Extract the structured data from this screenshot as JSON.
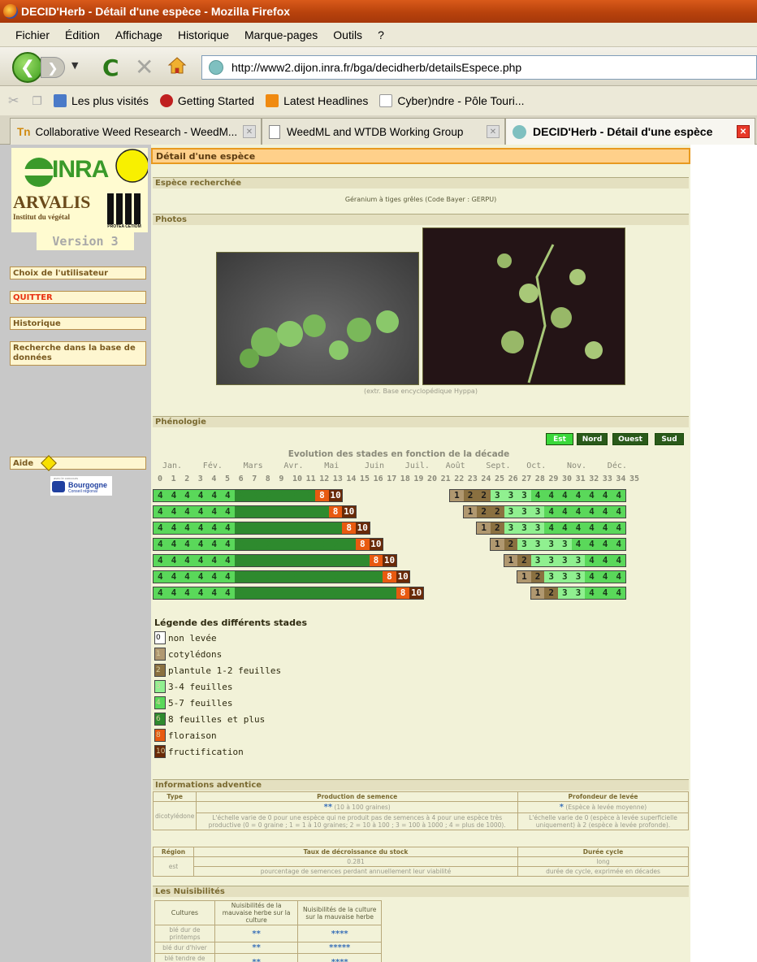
{
  "window": {
    "title": "DECID'Herb - Détail d'une espèce - Mozilla Firefox"
  },
  "menu": [
    "Fichier",
    "Édition",
    "Affichage",
    "Historique",
    "Marque-pages",
    "Outils",
    "?"
  ],
  "nav": {
    "url": "http://www2.dijon.inra.fr/bga/decidherb/detailsEspece.php"
  },
  "bookmarks": [
    "Les plus visités",
    "Getting Started",
    "Latest Headlines",
    "Cyber)ndre - Pôle Touri..."
  ],
  "tabs": [
    {
      "label": "Collaborative Weed Research - WeedM...",
      "active": false
    },
    {
      "label": "WeedML and WTDB Working Group",
      "active": false
    },
    {
      "label": "DECID'Herb - Détail d'une espèce",
      "active": true
    }
  ],
  "sidebar": {
    "logo_inra": "INRA",
    "logo_arvalis": "ARVALIS",
    "logo_arvalis_sub": "Institut du végétal",
    "logo_protea": "PROTEA CETIOM",
    "version": "Version 3",
    "items": [
      "Choix de l'utilisateur",
      "QUITTER",
      "Historique",
      "Recherche dans la base de données",
      "Aide"
    ],
    "bourgogne": "Bourgogne",
    "bourgogne_sub": "Conseil régional",
    "bourgogne_top": "avec le concours"
  },
  "page": {
    "title": "Détail d'une espèce",
    "section_search": "Espèce recherchée",
    "species": "Géranium à tiges grêles (Code Bayer : GERPU)",
    "section_photos": "Photos",
    "photo_credit": "(extr. Base encyclopédique Hyppa)",
    "section_pheno": "Phénologie",
    "region_buttons": [
      "Est",
      "Nord",
      "Ouest",
      "Sud"
    ],
    "pheno_title": "Evolution des stades en fonction de la décade",
    "months": [
      "Jan.",
      "Fév.",
      "Mars",
      "Avr.",
      "Mai",
      "Juin",
      "Juil.",
      "Août",
      "Sept.",
      "Oct.",
      "Nov.",
      "Déc."
    ],
    "decades": [
      "0",
      "1",
      "2",
      "3",
      "4",
      "5",
      "6",
      "7",
      "8",
      "9",
      "10",
      "11",
      "12",
      "13",
      "14",
      "15",
      "16",
      "17",
      "18",
      "19",
      "20",
      "21",
      "22",
      "23",
      "24",
      "25",
      "26",
      "27",
      "28",
      "29",
      "30",
      "31",
      "32",
      "33",
      "34",
      "35"
    ],
    "pheno_rows": [
      {
        "spring": "444444666666810",
        "autumn_start": 22,
        "autumn": "1223334444444"
      },
      {
        "spring": "4444446666666810",
        "autumn_start": 23,
        "autumn": "122333444444"
      },
      {
        "spring": "44444466666666810",
        "autumn_start": 24,
        "autumn": "12333444444"
      },
      {
        "spring": "444444666666666810",
        "autumn_start": 25,
        "autumn": "1233334444"
      },
      {
        "spring": "4444446666666666810",
        "autumn_start": 26,
        "autumn": "123333444"
      },
      {
        "spring": "44444466666666666810",
        "autumn_start": 27,
        "autumn": "12333444"
      },
      {
        "spring": "444444666666666666810",
        "autumn_start": 28,
        "autumn": "1233444"
      }
    ],
    "legend_title": "Légende des différents stades",
    "legend": [
      {
        "code": "0",
        "label": "non levée",
        "color": "#ffffff"
      },
      {
        "code": "1",
        "label": "cotylédons",
        "color": "#b09870"
      },
      {
        "code": "2",
        "label": "plantule 1-2 feuilles",
        "color": "#8a7040"
      },
      {
        "code": "3",
        "label": "3-4 feuilles",
        "color": "#90f090"
      },
      {
        "code": "4",
        "label": "5-7 feuilles",
        "color": "#5ad85a"
      },
      {
        "code": "6",
        "label": "8 feuilles et plus",
        "color": "#2e8a2e"
      },
      {
        "code": "8",
        "label": "floraison",
        "color": "#e85a10"
      },
      {
        "code": "10",
        "label": "fructification",
        "color": "#6a2a08"
      }
    ],
    "section_info": "Informations adventice",
    "info": {
      "h_type": "Type",
      "h_prod": "Production de semence",
      "h_prof": "Profondeur de levée",
      "type": "dicotylédone",
      "prod_stars": "**",
      "prod_val": "(10 à 100 graines)",
      "prod_desc": "L'échelle varie de 0 pour une espèce qui ne produit pas de semences à 4 pour une espèce très productive (0 = 0 graine ; 1 = 1 à 10 graines; 2 = 10 à 100 ; 3 = 100 à 1000 ; 4 = plus de 1000).",
      "prof_stars": "*",
      "prof_val": "(Espèce à levée moyenne)",
      "prof_desc": "L'échelle varie de 0 (espèce à levée superficielle uniquement) à 2 (espèce à levée profonde).",
      "h_region": "Région",
      "h_taux": "Taux de décroissance du stock",
      "h_duree": "Durée cycle",
      "region": "est",
      "taux": "0.281",
      "taux_desc": "pourcentage de semences perdant annuellement leur viabilité",
      "duree": "long",
      "duree_desc": "durée de cycle, exprimée en décades"
    },
    "section_nuis": "Les Nuisibilités",
    "nuis": {
      "h_cultures": "Cultures",
      "h_mh": "Nuisibilités de la mauvaise herbe sur la culture",
      "h_cult": "Nuisibilités de la culture sur la mauvaise herbe",
      "rows": [
        {
          "culture": "blé dur de printemps",
          "a": "**",
          "b": "****"
        },
        {
          "culture": "blé dur d'hiver",
          "a": "**",
          "b": "*****"
        },
        {
          "culture": "blé tendre de printemps",
          "a": "**",
          "b": "****"
        }
      ]
    }
  }
}
